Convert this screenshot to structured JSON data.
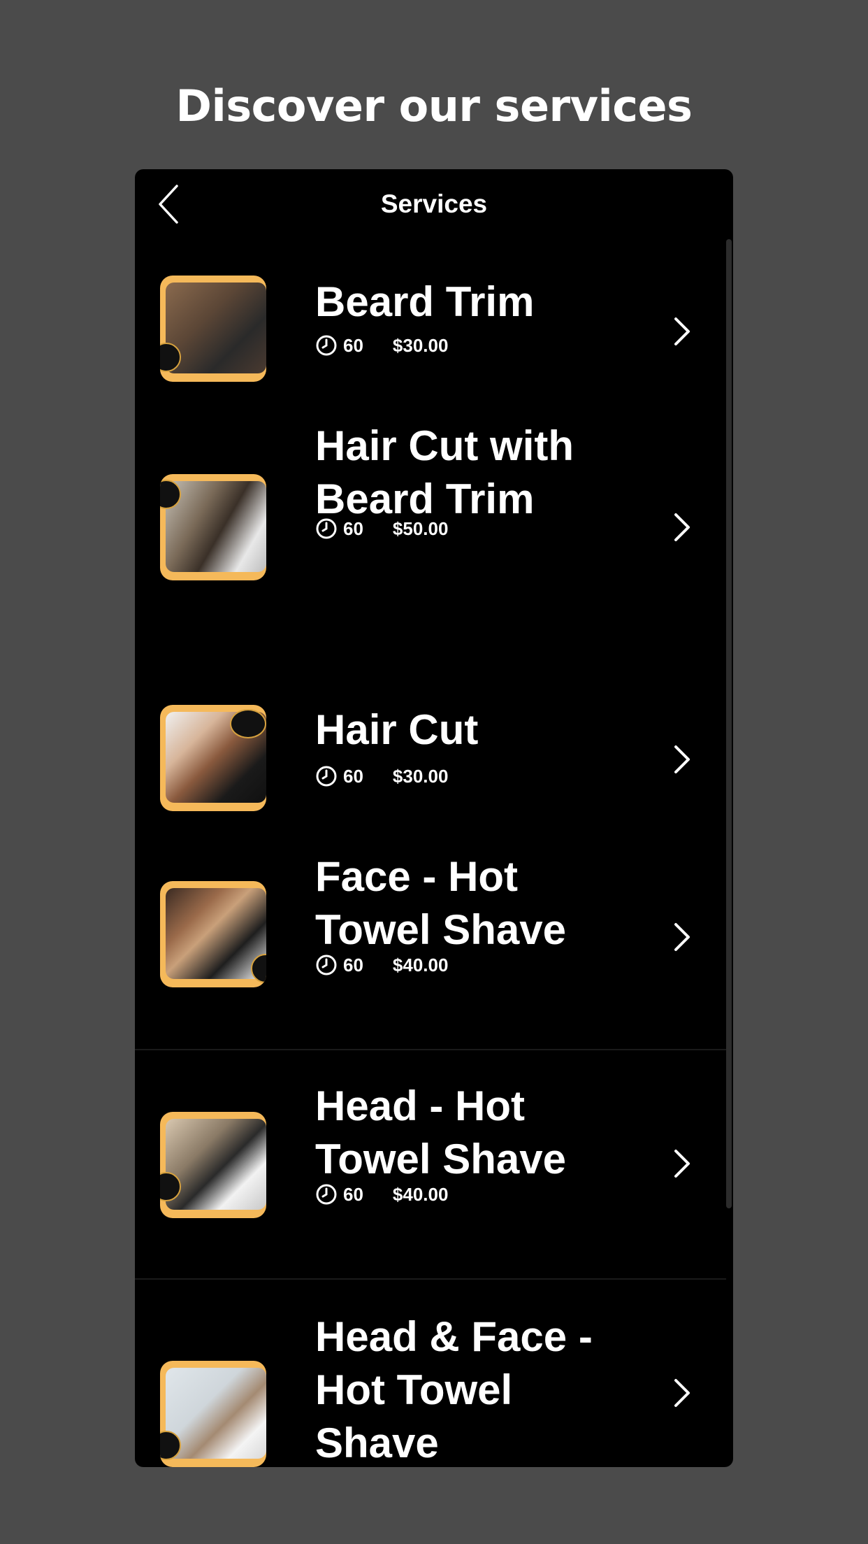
{
  "page": {
    "heading": "Discover our services"
  },
  "nav": {
    "title": "Services",
    "back_icon": "chevron-left-icon"
  },
  "icons": {
    "duration": "clock-icon",
    "row_action": "chevron-right-icon"
  },
  "colors": {
    "background": "#4b4b4b",
    "panel": "#000000",
    "thumbnail_frame": "#f5b95a",
    "text": "#ffffff"
  },
  "services": [
    {
      "title": "Beard Trim",
      "duration": "60",
      "price": "$30.00"
    },
    {
      "title": "Hair Cut with Beard Trim",
      "duration": "60",
      "price": "$50.00"
    },
    {
      "title": "Hair Cut",
      "duration": "60",
      "price": "$30.00"
    },
    {
      "title": "Face - Hot Towel Shave",
      "duration": "60",
      "price": "$40.00"
    },
    {
      "title": "Head - Hot Towel Shave",
      "duration": "60",
      "price": "$40.00"
    },
    {
      "title": "Head & Face - Hot Towel Shave"
    }
  ]
}
